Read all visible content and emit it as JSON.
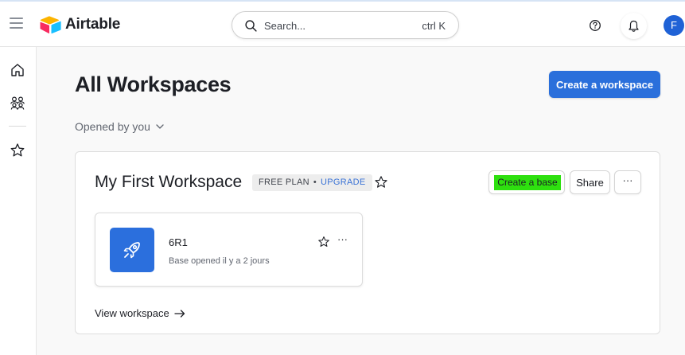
{
  "app": {
    "name": "Airtable"
  },
  "header": {
    "search_placeholder": "Search...",
    "search_shortcut": "ctrl K",
    "avatar_initial": "F"
  },
  "sidebar": {
    "icons": [
      "home-icon",
      "workspaces-icon",
      "star-icon"
    ]
  },
  "main": {
    "title": "All Workspaces",
    "create_workspace_label": "Create a workspace",
    "filter_label": "Opened by you"
  },
  "workspace": {
    "name": "My First Workspace",
    "plan": "FREE PLAN",
    "separator": "•",
    "upgrade": "UPGRADE",
    "create_base_label": "Create a base",
    "share_label": "Share",
    "more_label": "···",
    "base": {
      "name": "6R1",
      "meta": "Base opened il y a 2 jours",
      "more_label": "···"
    },
    "view_label": "View workspace"
  },
  "colors": {
    "accent": "#2a6fdb",
    "avatar": "#1f62d6",
    "highlight": "#2ee00f",
    "base_icon_bg": "#2b6fdd"
  }
}
